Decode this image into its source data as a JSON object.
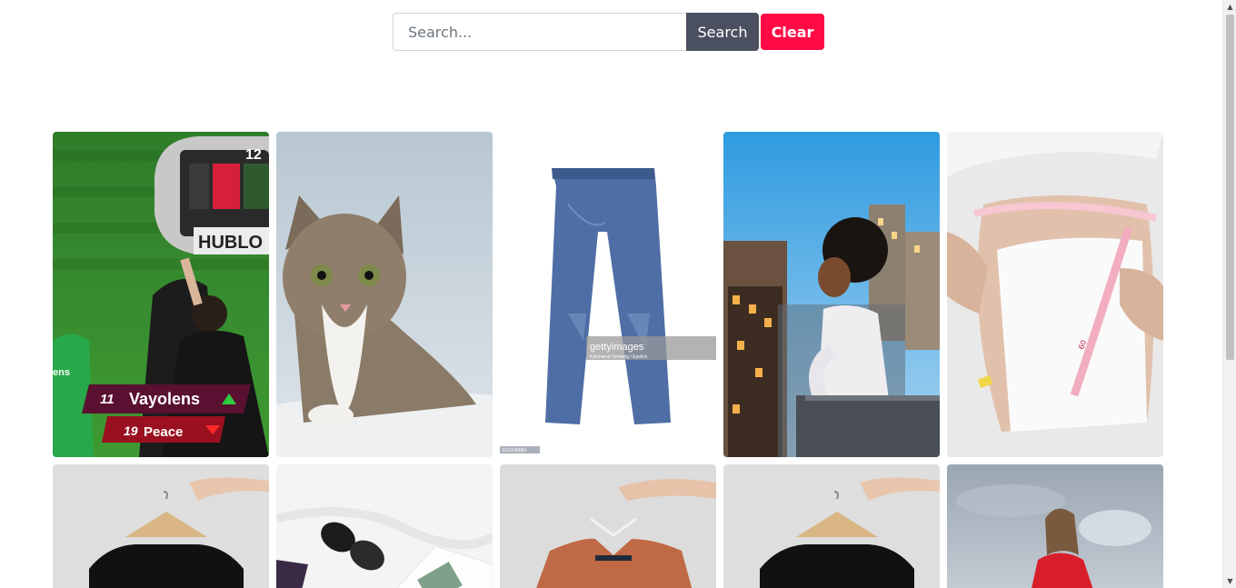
{
  "search": {
    "placeholder": "Search...",
    "value": "",
    "search_label": "Search",
    "clear_label": "Clear"
  },
  "images": [
    {
      "name": "football-substitution-board",
      "overlay": {
        "brand": "HUBLO",
        "board_top": "12",
        "player_in_num": "11",
        "player_in_name": "Vayolens",
        "player_out_num": "19",
        "player_out_name": "Peace",
        "jersey_text": "ens"
      }
    },
    {
      "name": "tabby-kitten"
    },
    {
      "name": "blue-jeans",
      "overlay": {
        "watermark": "gettyimages",
        "credit": "Kritchanut Onmang / EyeEm",
        "id": "1161148084"
      }
    },
    {
      "name": "woman-city-balcony"
    },
    {
      "name": "measuring-tape-waist",
      "overlay": {
        "tape_num": "60"
      }
    },
    {
      "name": "black-tshirt-hanger"
    },
    {
      "name": "flatlay-sunglasses"
    },
    {
      "name": "orange-jacket-hanger"
    },
    {
      "name": "black-tshirt-hanger-2"
    },
    {
      "name": "woman-red-sweater-sky"
    }
  ],
  "colors": {
    "search_button": "#4a5060",
    "clear_button": "#ff0a45"
  },
  "icons": {
    "scroll_up": "▲",
    "scroll_down": "▼"
  }
}
